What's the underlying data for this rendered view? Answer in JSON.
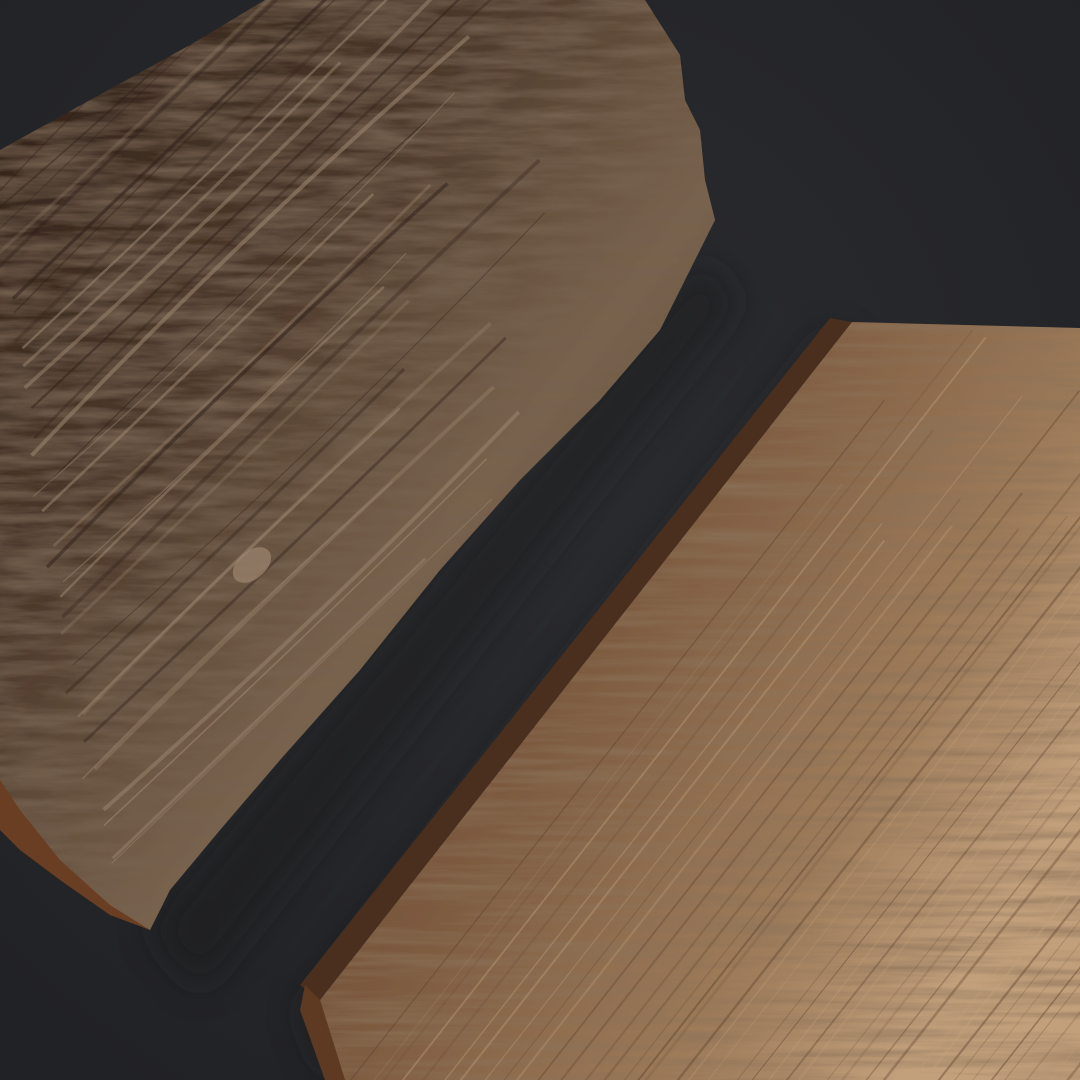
{
  "scene": {
    "description_free": true,
    "colors": {
      "background": "#2b2c30",
      "background_vignette": "#202124",
      "shadow": "#1a1b1e",
      "log_bark_dark": "#2e2019",
      "log_bark_mid": "#4e3a2c",
      "log_bark_light": "#7a644e",
      "log_bark_highlight": "#9c8670",
      "log_end_grain": "#6a3e22",
      "plank_top_dark": "#5a3e2a",
      "plank_top_mid": "#7c5a40",
      "plank_top_light": "#a07e5c",
      "plank_top_highlight": "#c2a07c",
      "plank_side": "#4a2f1e",
      "plank_end_grain": "#5e3a22"
    },
    "objects": [
      {
        "name": "weathered-log",
        "material": "rough-bark-wood"
      },
      {
        "name": "wooden-plank",
        "material": "sawn-weathered-wood"
      }
    ]
  }
}
